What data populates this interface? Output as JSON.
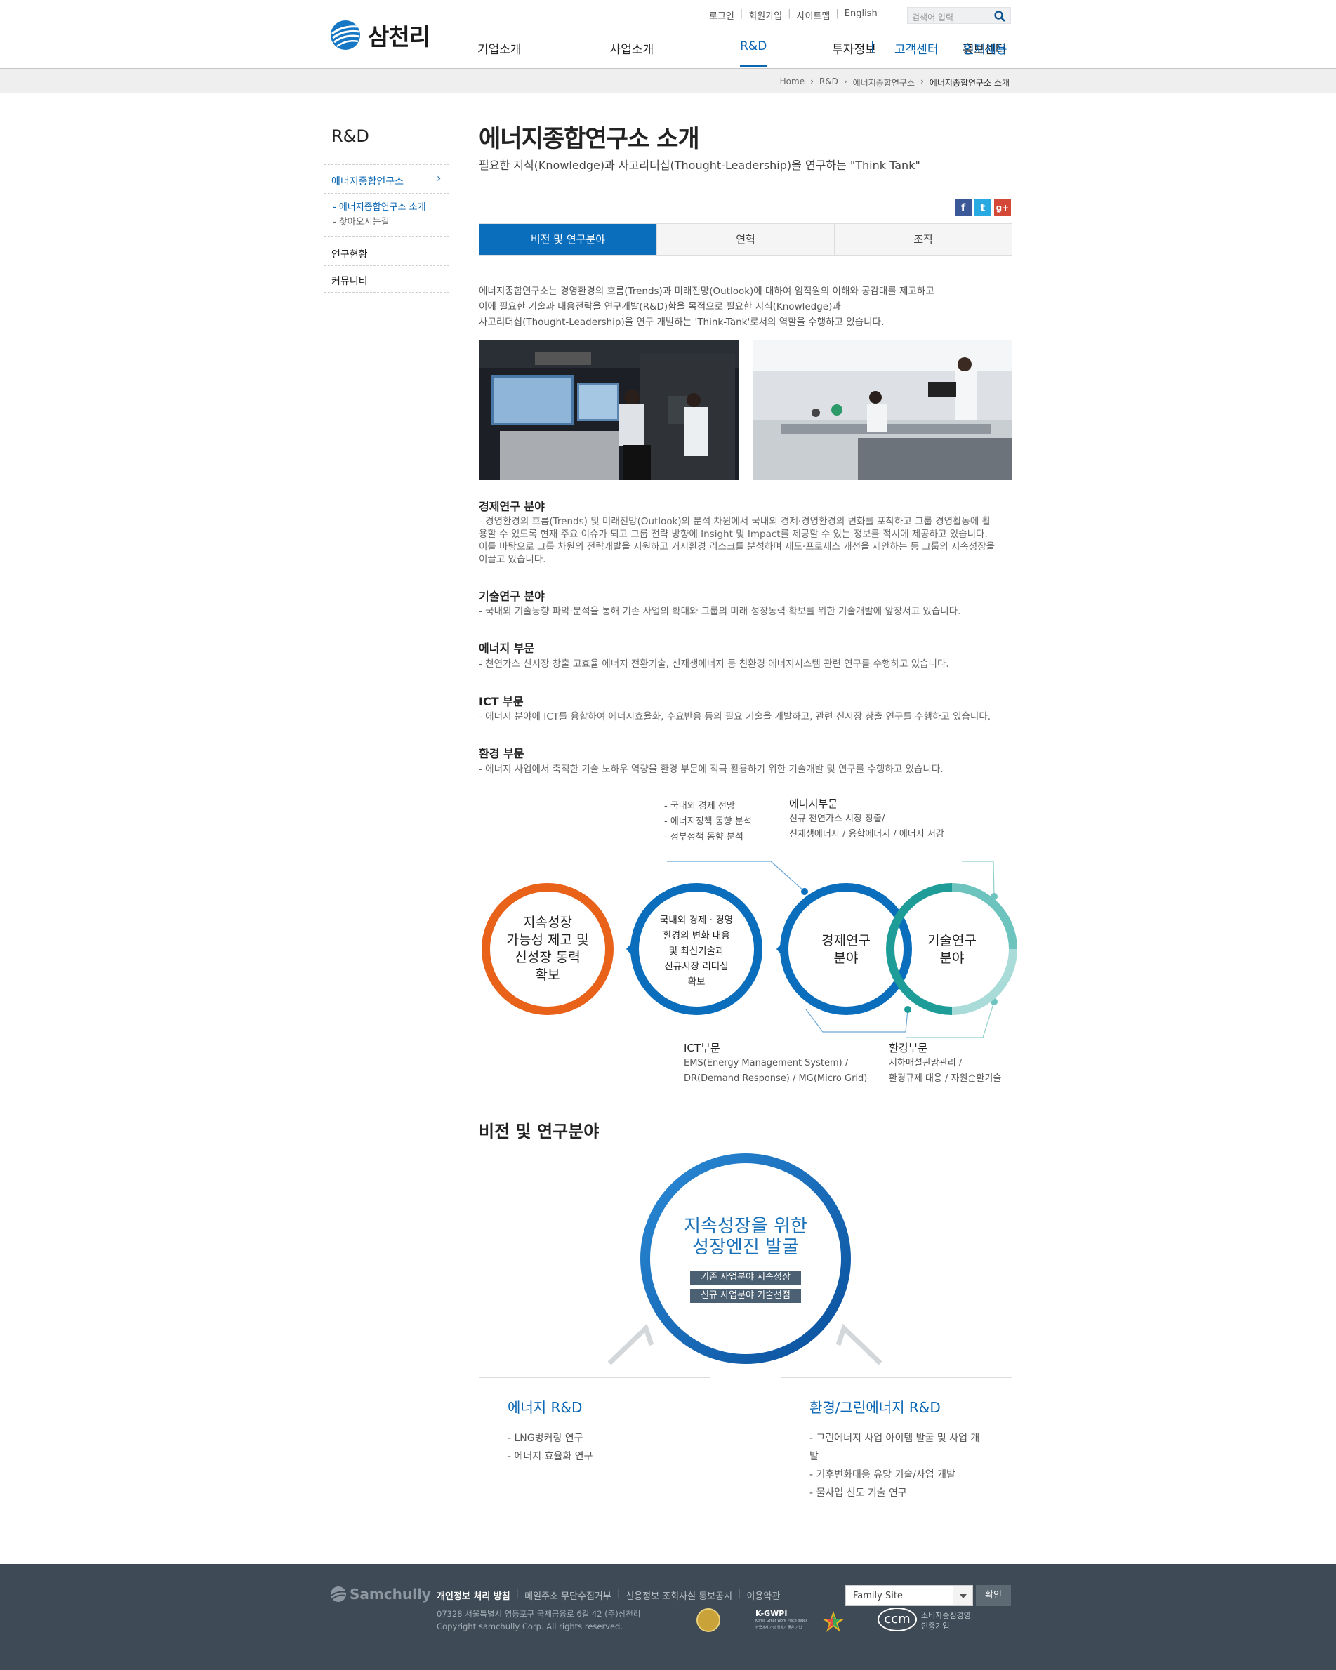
{
  "header": {
    "logo_text": "삼천리",
    "util_links": [
      "로그인",
      "회원가입",
      "사이트맵",
      "English"
    ],
    "search_placeholder": "검색어 입력",
    "gnb": [
      "기업소개",
      "사업소개",
      "R&D",
      "투자정보",
      "홍보센터"
    ],
    "gnb_right": [
      "고객센터",
      "인재채용"
    ],
    "active_menu": "R&D"
  },
  "breadcrumb": [
    "Home",
    "R&D",
    "에너지종합연구소",
    "에너지종합연구소 소개"
  ],
  "sidebar": {
    "title": "R&D",
    "items": [
      {
        "label": "에너지종합연구소",
        "active": true
      },
      {
        "label": "연구현황"
      },
      {
        "label": "커뮤니티"
      }
    ],
    "sub_items": [
      "에너지종합연구소 소개",
      "찾아오시는길"
    ]
  },
  "content": {
    "title": "에너지종합연구소 소개",
    "subtitle": "필요한 지식(Knowledge)과 사고리더십(Thought-Leadership)을 연구하는 \"Think Tank\"",
    "sns": [
      "f",
      "t",
      "g+"
    ],
    "tabs": [
      "비전 및 연구분야",
      "연혁",
      "조직"
    ],
    "intro": [
      "에너지종합연구소는 경영환경의 흐름(Trends)과 미래전망(Outlook)에 대하여 임직원의 이해와 공감대를 제고하고",
      "이에 필요한 기술과 대응전략을 연구개발(R&D)함을 목적으로 필요한 지식(Knowledge)과",
      "사고리더십(Thought-Leadership)을 연구 개발하는 'Think-Tank'로서의 역할을 수행하고 있습니다."
    ],
    "sections": [
      {
        "title": "경제연구 분야",
        "text": "- 경영환경의 흐름(Trends) 및 미래전망(Outlook)의 분석 차원에서 국내외 경제·경영환경의 변화를 포착하고 그룹 경영활동에 활용할 수 있도록 현재 주요 이슈가 되고 그룹 전략 방향에 Insight 및 Impact를 제공할 수 있는 정보를 적시에 제공하고 있습니다. 이를 바탕으로 그룹 차원의 전략개발을 지원하고 거시환경 리스크를 분석하며 제도·프로세스 개선을 제안하는 등 그룹의 지속성장을 이끌고 있습니다."
      },
      {
        "title": "기술연구 분야",
        "text": "- 국내외 기술동향 파악·분석을 통해 기존 사업의 확대와 그룹의 미래 성장동력 확보를 위한 기술개발에 앞장서고 있습니다."
      },
      {
        "title": "에너지 부문",
        "text": "- 천연가스 신시장 창출 고효율 에너지 전환기술, 신재생에너지 등 친환경 에너지시스템 관련 연구를 수행하고 있습니다."
      },
      {
        "title": "ICT 부문",
        "text": "- 에너지 분야에 ICT를 융합하여 에너지효율화, 수요반응 등의 필요 기술을 개발하고, 관련 신시장 창출 연구를 수행하고 있습니다."
      },
      {
        "title": "환경 부문",
        "text": "- 에너지 사업에서 축적한 기술 노하우 역량을 환경 부문에 적극 활용하기 위한 기술개발 및 연구를 수행하고 있습니다."
      }
    ]
  },
  "diagram": {
    "bullets": [
      "국내외 경제 전망",
      "에너지정책 동향 분석",
      "정부정책 동향 분석"
    ],
    "energy_title": "에너지부문",
    "energy_lines": [
      "신규 천연가스 시장 창출/",
      "신재생에너지 / 융합에너지 / 에너지 저감"
    ],
    "circle1": [
      "지속성장",
      "가능성 제고 및",
      "신성장 동력",
      "확보"
    ],
    "circle2": [
      "국내외 경제 · 경영",
      "환경의 변화 대응",
      "및 최신기술과",
      "신규시장 리더십",
      "확보"
    ],
    "circle3": [
      "경제연구",
      "분야"
    ],
    "circle4": [
      "기술연구",
      "분야"
    ],
    "ict_title": "ICT부문",
    "ict_lines": [
      "EMS(Energy Management System) /",
      "DR(Demand Response) / MG(Micro Grid)"
    ],
    "env_title": "환경부문",
    "env_lines": [
      "지하매설관망관리 /",
      "환경규제 대응 / 자원순환기술"
    ]
  },
  "vision": {
    "title": "비전 및 연구분야",
    "center": [
      "지속성장을 위한",
      "성장엔진 발굴"
    ],
    "tags": [
      "기존 사업분야 지속성장",
      "신규 사업분야 기술선점"
    ],
    "boxes": [
      {
        "title": "에너지 R&D",
        "items": [
          "- LNG벙커링 연구",
          "- 에너지 효율화 연구"
        ]
      },
      {
        "title": "환경/그린에너지 R&D",
        "items": [
          "- 그린에너지 사업 아이템 발굴 및 사업 개발",
          "- 기후변화대응 유망 기술/사업 개발",
          "- 물사업 선도 기술 연구"
        ]
      }
    ]
  },
  "footer": {
    "logo": "Samchully",
    "links": [
      "개인정보 처리 방침",
      "메일주소 무단수집거부",
      "신용정보 조회사실 통보공시",
      "이용약관"
    ],
    "address": "07328 서울특별시 영등포구 국제금융로 6길 42 (주)삼천리",
    "copyright": "Copyright samchully Corp. All rights reserved.",
    "family_site": "Family Site",
    "confirm": "확인",
    "kgwp_title": "K-GWPI",
    "kgwp_sub": "Korea Great Work Place Index",
    "kgwp_sub2": "한국에서 가장 일하기 좋은 기업",
    "ccm_text": "ccm",
    "ccm_lines": [
      "소비자중심경영",
      "인증기업"
    ]
  },
  "colors": {
    "brand": "#0a6ebd",
    "orange": "#e8621a",
    "teal": "#1e9c97",
    "footer": "#3e4a55"
  }
}
